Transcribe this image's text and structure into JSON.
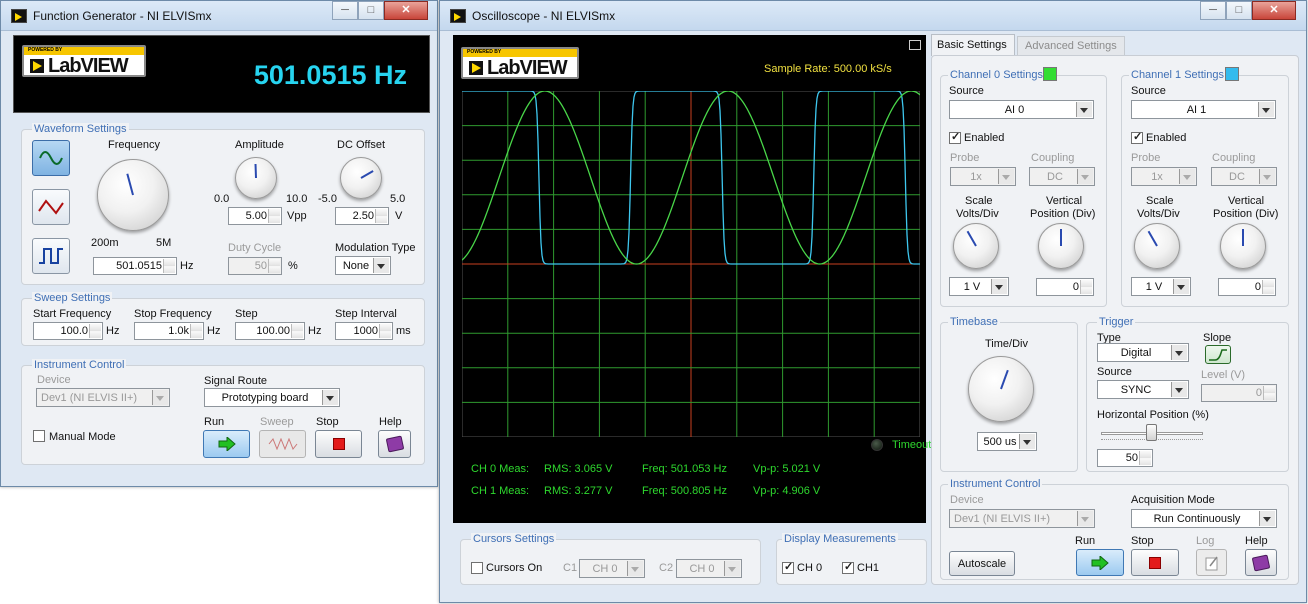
{
  "fg": {
    "title": "Function Generator - NI ELVISmx",
    "logo": "LabVIEW",
    "logo_small": "POWERED BY",
    "freq_display": "501.0515 Hz",
    "waveform": {
      "title": "Waveform Settings",
      "frequency_label": "Frequency",
      "freq_min": "200m",
      "freq_max": "5M",
      "frequency_value": "501.0515",
      "frequency_unit": "Hz",
      "amplitude_label": "Amplitude",
      "amp_min": "0.0",
      "amp_max": "10.0",
      "amplitude_value": "5.00",
      "amplitude_unit": "Vpp",
      "dc_label": "DC Offset",
      "dc_min": "-5.0",
      "dc_max": "5.0",
      "dc_value": "2.50",
      "dc_unit": "V",
      "duty_label": "Duty Cycle",
      "duty_value": "50",
      "duty_unit": "%",
      "mod_label": "Modulation Type",
      "mod_value": "None"
    },
    "sweep": {
      "title": "Sweep Settings",
      "start_label": "Start Frequency",
      "start_value": "100.0",
      "start_unit": "Hz",
      "stop_label": "Stop Frequency",
      "stop_value": "1.0k",
      "stop_unit": "Hz",
      "step_label": "Step",
      "step_value": "100.00",
      "step_unit": "Hz",
      "interval_label": "Step Interval",
      "interval_value": "1000",
      "interval_unit": "ms"
    },
    "instrument": {
      "title": "Instrument Control",
      "device_label": "Device",
      "device_value": "Dev1 (NI ELVIS II+)",
      "route_label": "Signal Route",
      "route_value": "Prototyping board",
      "manual_label": "Manual Mode",
      "run_label": "Run",
      "sweep_label": "Sweep",
      "stop_label": "Stop",
      "help_label": "Help"
    }
  },
  "osc": {
    "title": "Oscilloscope - NI ELVISmx",
    "logo": "LabVIEW",
    "logo_small": "POWERED BY",
    "sample_rate": "Sample Rate:  500.00 kS/s",
    "timeout": "Timeout",
    "meas": [
      {
        "label": "CH 0 Meas:",
        "rms": "RMS:  3.065 V",
        "freq": "Freq:  501.053 Hz",
        "vpp": "Vp-p:  5.021 V"
      },
      {
        "label": "CH 1 Meas:",
        "rms": "RMS:  3.277 V",
        "freq": "Freq:  500.805 Hz",
        "vpp": "Vp-p:  4.906 V"
      }
    ],
    "cursors": {
      "title": "Cursors Settings",
      "on_label": "Cursors On",
      "c1_label": "C1",
      "c1_value": "CH 0",
      "c2_label": "C2",
      "c2_value": "CH 0"
    },
    "display": {
      "title": "Display Measurements",
      "ch0": "CH 0",
      "ch1": "CH1"
    },
    "tabs": [
      "Basic Settings",
      "Advanced Settings"
    ],
    "ch0": {
      "title": "Channel 0 Settings",
      "color": "#33dd33",
      "source_label": "Source",
      "source_value": "AI 0",
      "enabled_label": "Enabled",
      "probe_label": "Probe",
      "probe_value": "1x",
      "coupling_label": "Coupling",
      "coupling_value": "DC",
      "scale_label1": "Scale",
      "scale_label2": "Volts/Div",
      "vpos_label1": "Vertical",
      "vpos_label2": "Position (Div)",
      "scale_value": "1 V",
      "vpos_value": "0"
    },
    "ch1": {
      "title": "Channel 1 Settings",
      "color": "#33bbee",
      "source_label": "Source",
      "source_value": "AI 1",
      "enabled_label": "Enabled",
      "probe_label": "Probe",
      "probe_value": "1x",
      "coupling_label": "Coupling",
      "coupling_value": "DC",
      "scale_label1": "Scale",
      "scale_label2": "Volts/Div",
      "vpos_label1": "Vertical",
      "vpos_label2": "Position (Div)",
      "scale_value": "1 V",
      "vpos_value": "0"
    },
    "timebase": {
      "title": "Timebase",
      "label": "Time/Div",
      "value": "500 us"
    },
    "trigger": {
      "title": "Trigger",
      "type_label": "Type",
      "type_value": "Digital",
      "slope_label": "Slope",
      "source_label": "Source",
      "source_value": "SYNC",
      "level_label": "Level (V)",
      "level_value": "0",
      "hpos_label": "Horizontal Position (%)",
      "hpos_value": "50"
    },
    "instrument": {
      "title": "Instrument Control",
      "device_label": "Device",
      "device_value": "Dev1 (NI ELVIS II+)",
      "acq_label": "Acquisition Mode",
      "acq_value": "Run Continuously",
      "autoscale": "Autoscale",
      "run_label": "Run",
      "stop_label": "Stop",
      "log_label": "Log",
      "help_label": "Help"
    }
  }
}
